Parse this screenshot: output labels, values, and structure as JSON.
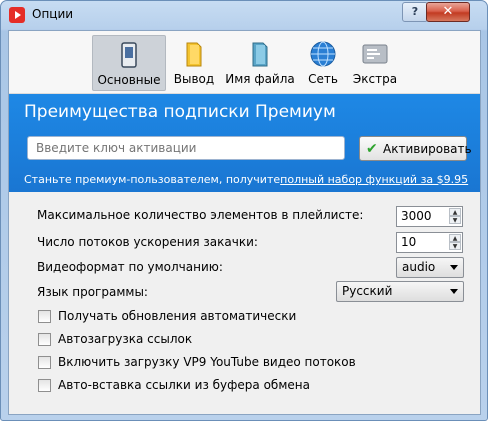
{
  "window": {
    "title": "Опции",
    "help_label": "?",
    "close_label": "✕"
  },
  "toolbar": {
    "tabs": [
      {
        "label": "Основные",
        "icon": "general-icon",
        "active": true
      },
      {
        "label": "Вывод",
        "icon": "folder-icon",
        "active": false
      },
      {
        "label": "Имя файла",
        "icon": "blue-folder-icon",
        "active": false
      },
      {
        "label": "Сеть",
        "icon": "globe-icon",
        "active": false
      },
      {
        "label": "Экстра",
        "icon": "extra-icon",
        "active": false
      }
    ]
  },
  "premium": {
    "title": "Преимущества подписки Премиум",
    "key_placeholder": "Введите ключ активации",
    "activate_label": "Активировать",
    "promo_text": "Станьте премиум-пользователем, получите",
    "promo_link": "полный набор функций за $9.95"
  },
  "settings": {
    "max_items_label": "Максимальное количество элементов в плейлисте:",
    "max_items_value": "3000",
    "threads_label": "Число потоков ускорения закачки:",
    "threads_value": "10",
    "format_label": "Видеоформат по умолчанию:",
    "format_value": "audio",
    "language_label": "Язык программы:",
    "language_value": "Русский"
  },
  "checkboxes": [
    {
      "label": "Получать обновления автоматически",
      "checked": false
    },
    {
      "label": "Автозагрузка ссылок",
      "checked": false
    },
    {
      "label": "Включить загрузку VP9 YouTube видео потоков",
      "checked": false
    },
    {
      "label": "Авто-вставка ссылки из буфера обмена",
      "checked": false
    }
  ],
  "colors": {
    "banner": "#1e88e5",
    "accent_check": "#2ea32e",
    "close_button": "#c23b22"
  }
}
